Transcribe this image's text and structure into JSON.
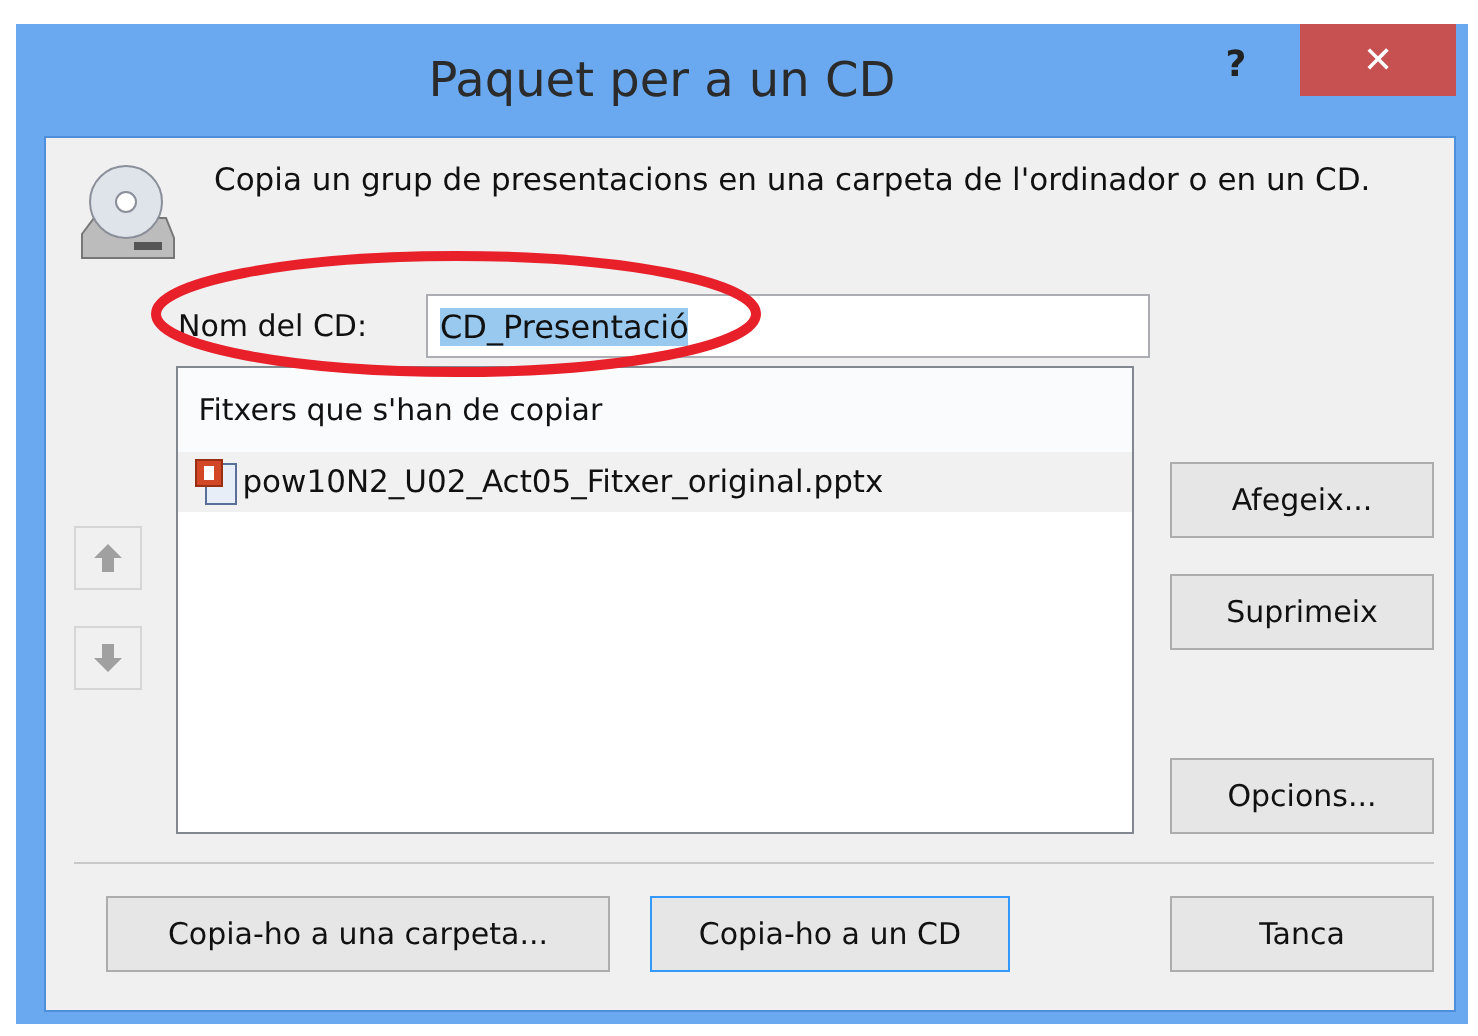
{
  "window": {
    "title": "Paquet per a un CD",
    "help": "?",
    "close": "✕"
  },
  "description": "Copia un grup de presentacions en una carpeta de l'ordinador o en un CD.",
  "cd_name": {
    "label": "Nom del CD:",
    "value": "CD_Presentació",
    "selected": true
  },
  "annotation": {
    "kind": "ellipse",
    "color": "#e8202a"
  },
  "file_list": {
    "header": "Fitxers que s'han de copiar",
    "items": [
      {
        "name": "pow10N2_U02_Act05_Fitxer_original.pptx",
        "selected": true
      }
    ]
  },
  "move_buttons": [
    {
      "kind": "up",
      "disabled": true
    },
    {
      "kind": "down",
      "disabled": true
    }
  ],
  "side_buttons": [
    "Afegeix...",
    "Suprimeix",
    "Opcions..."
  ],
  "footer_buttons": [
    {
      "label": "Copia-ho a una carpeta...",
      "focused": false
    },
    {
      "label": "Copia-ho a un CD",
      "focused": true
    },
    {
      "label": "Tanca",
      "focused": false
    }
  ]
}
